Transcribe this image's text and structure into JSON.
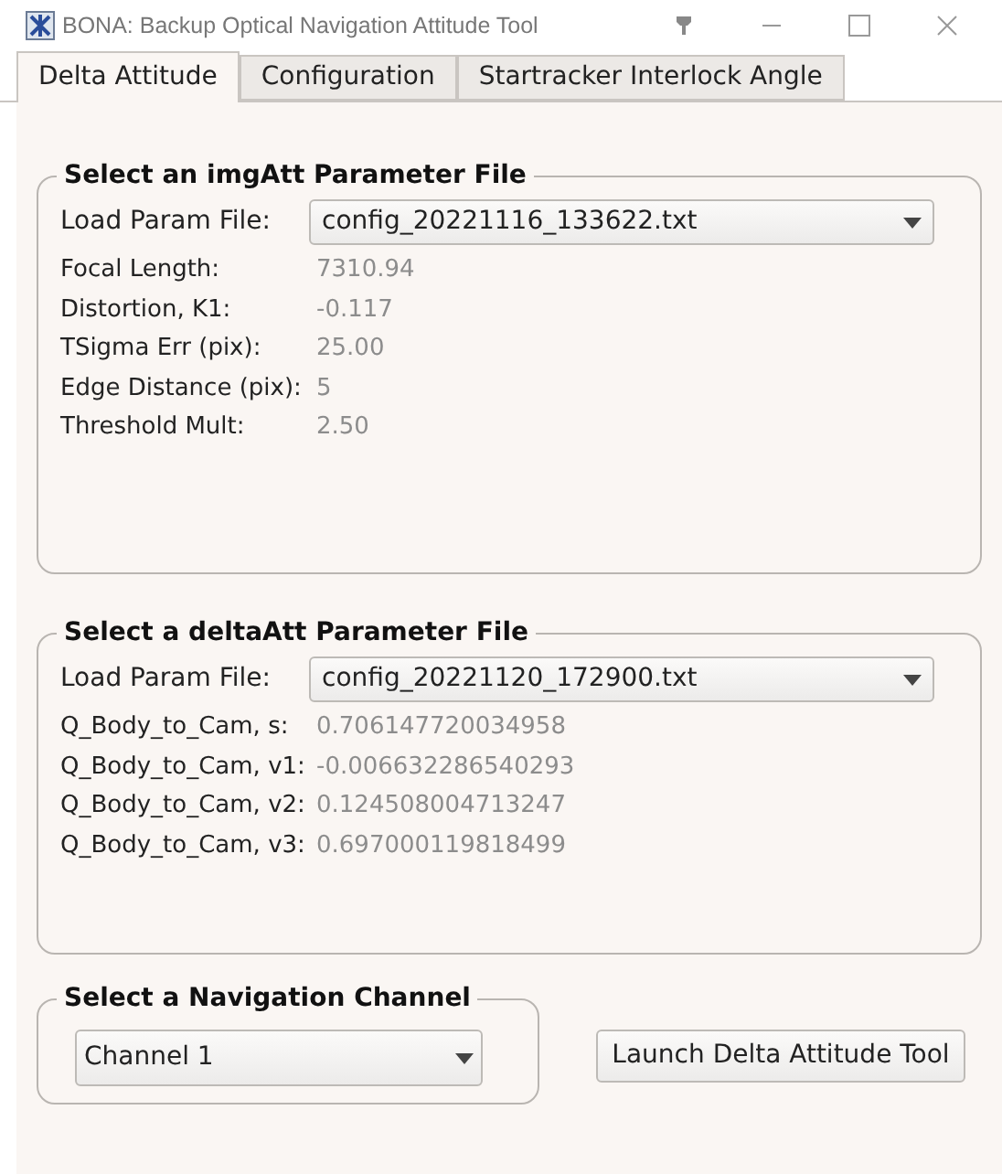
{
  "window": {
    "title": "BONA: Backup Optical Navigation Attitude Tool"
  },
  "tabs": [
    {
      "label": "Delta Attitude",
      "selected": true
    },
    {
      "label": "Configuration",
      "selected": false
    },
    {
      "label": "Startracker Interlock Angle",
      "selected": false
    }
  ],
  "groups": [
    {
      "title": "Select an imgAtt Parameter File",
      "load_label": "Load Param File:",
      "file": "config_20221116_133622.txt",
      "fields": [
        {
          "label": "Focal Length:",
          "value": "7310.94"
        },
        {
          "label": "Distortion, K1:",
          "value": "-0.117"
        },
        {
          "label": "TSigma Err (pix):",
          "value": "25.00"
        },
        {
          "label": "Edge Distance (pix):",
          "value": "5"
        },
        {
          "label": "Threshold Mult:",
          "value": "2.50"
        }
      ]
    },
    {
      "title": "Select a deltaAtt Parameter File",
      "load_label": "Load Param File:",
      "file": "config_20221120_172900.txt",
      "fields": [
        {
          "label": "Q_Body_to_Cam, s:",
          "value": "0.706147720034958"
        },
        {
          "label": "Q_Body_to_Cam, v1:",
          "value": "-0.006632286540293"
        },
        {
          "label": "Q_Body_to_Cam, v2:",
          "value": "0.124508004713247"
        },
        {
          "label": "Q_Body_to_Cam, v3:",
          "value": "0.697000119818499"
        }
      ]
    }
  ],
  "channel_group": {
    "title": "Select a Navigation Channel",
    "channel": "Channel 1"
  },
  "launch_button": "Launch Delta Attitude Tool"
}
